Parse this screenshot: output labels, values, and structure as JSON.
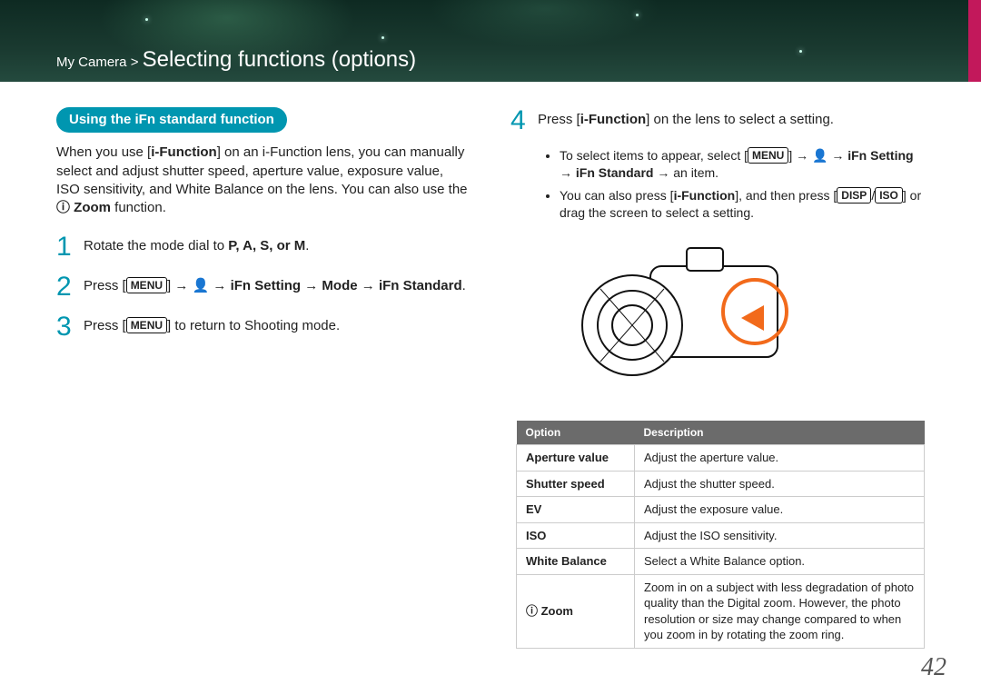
{
  "header": {
    "crumb_prefix": "My Camera",
    "crumb_sep": " > ",
    "title": "Selecting functions (options)"
  },
  "left": {
    "pill": "Using the iFn standard function",
    "intro_a": "When you use [",
    "intro_b": "i-Function",
    "intro_c": "] on an i-Function lens, you can manually select and adjust shutter speed, aperture value, exposure value, ISO sensitivity, and White Balance on the lens. You can also use the ",
    "intro_zoom_prefix": "ⓘ ",
    "intro_zoom": "Zoom",
    "intro_d": " function.",
    "step1_num": "1",
    "step1_a": "Rotate the mode dial to ",
    "step1_modes": "P, A, S, or M",
    "step1_b": ".",
    "step2_num": "2",
    "step2_a": "Press [",
    "step2_menu": "MENU",
    "step2_b": "] → ",
    "step2_icon": "👤",
    "step2_c": " → ",
    "step2_d": "iFn Setting",
    "step2_e": " → ",
    "step2_f": "Mode",
    "step2_g": " → ",
    "step2_h": "iFn Standard",
    "step2_i": ".",
    "step3_num": "3",
    "step3_a": "Press [",
    "step3_menu": "MENU",
    "step3_b": "] to return to Shooting mode."
  },
  "right": {
    "step4_num": "4",
    "step4_a": "Press [",
    "step4_b": "i-Function",
    "step4_c": "] on the lens to select a setting.",
    "b1_a": "To select items to appear, select [",
    "b1_menu": "MENU",
    "b1_b": "] → ",
    "b1_icon": "👤",
    "b1_c": " → ",
    "b1_d": "iFn Setting",
    "b1_e": " → ",
    "b1_f": "iFn Standard",
    "b1_g": " → an item.",
    "b2_a": "You can also press [",
    "b2_b": "i-Function",
    "b2_c": "], and then press [",
    "b2_disp": "DISP",
    "b2_sep": "/",
    "b2_iso": "ISO",
    "b2_d": "] or drag the screen to select a setting.",
    "table": {
      "h1": "Option",
      "h2": "Description",
      "rows": [
        {
          "opt": "Aperture value",
          "desc": "Adjust the aperture value."
        },
        {
          "opt": "Shutter speed",
          "desc": "Adjust the shutter speed."
        },
        {
          "opt": "EV",
          "desc": "Adjust the exposure value."
        },
        {
          "opt": "ISO",
          "desc": "Adjust the ISO sensitivity."
        },
        {
          "opt": "White Balance",
          "desc": "Select a White Balance option."
        },
        {
          "opt": "ⓘ Zoom",
          "desc": "Zoom in on a subject with less degradation of photo quality than the Digital zoom. However, the photo resolution or size may change compared to when you zoom in by rotating the zoom ring."
        }
      ]
    }
  },
  "page_number": "42"
}
